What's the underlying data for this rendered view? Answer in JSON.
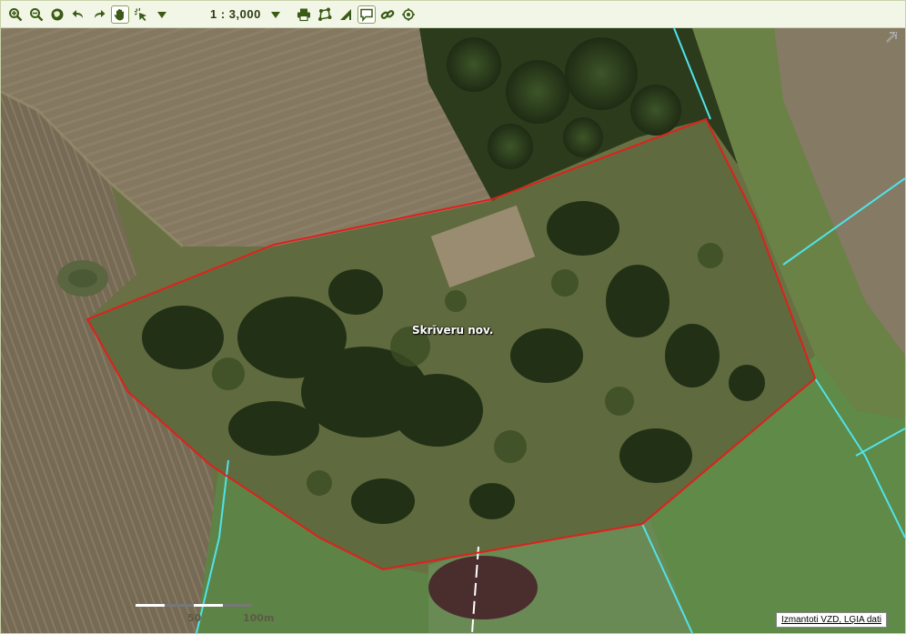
{
  "toolbar": {
    "scale": "1 : 3,000",
    "tools": [
      {
        "name": "zoom-in-icon"
      },
      {
        "name": "zoom-out-icon"
      },
      {
        "name": "full-extent-icon"
      },
      {
        "name": "undo-icon"
      },
      {
        "name": "redo-icon"
      },
      {
        "name": "pan-hand-icon",
        "active": true
      },
      {
        "name": "identify-icon"
      },
      {
        "name": "tool-dropdown-icon"
      },
      {
        "name": "scale-dropdown-icon"
      },
      {
        "name": "print-icon"
      },
      {
        "name": "measure-area-icon"
      },
      {
        "name": "measure-angle-icon"
      },
      {
        "name": "comment-icon",
        "active": true
      },
      {
        "name": "link-icon"
      },
      {
        "name": "location-icon"
      }
    ]
  },
  "map": {
    "parcel_label": "Skrīveru nov.",
    "scalebar": {
      "label_mid": "50",
      "label_end": "100m"
    },
    "attribution": "Izmantoti VZD, LĢIA dati",
    "colors": {
      "parcel_boundary": "#e0201c",
      "cadastre_lines": "#4fe3ea",
      "field_brown": "#7a6e58",
      "field_green": "#5f8a48",
      "forest_dark": "#2b3b1c",
      "meadow": "#6b7448"
    }
  }
}
